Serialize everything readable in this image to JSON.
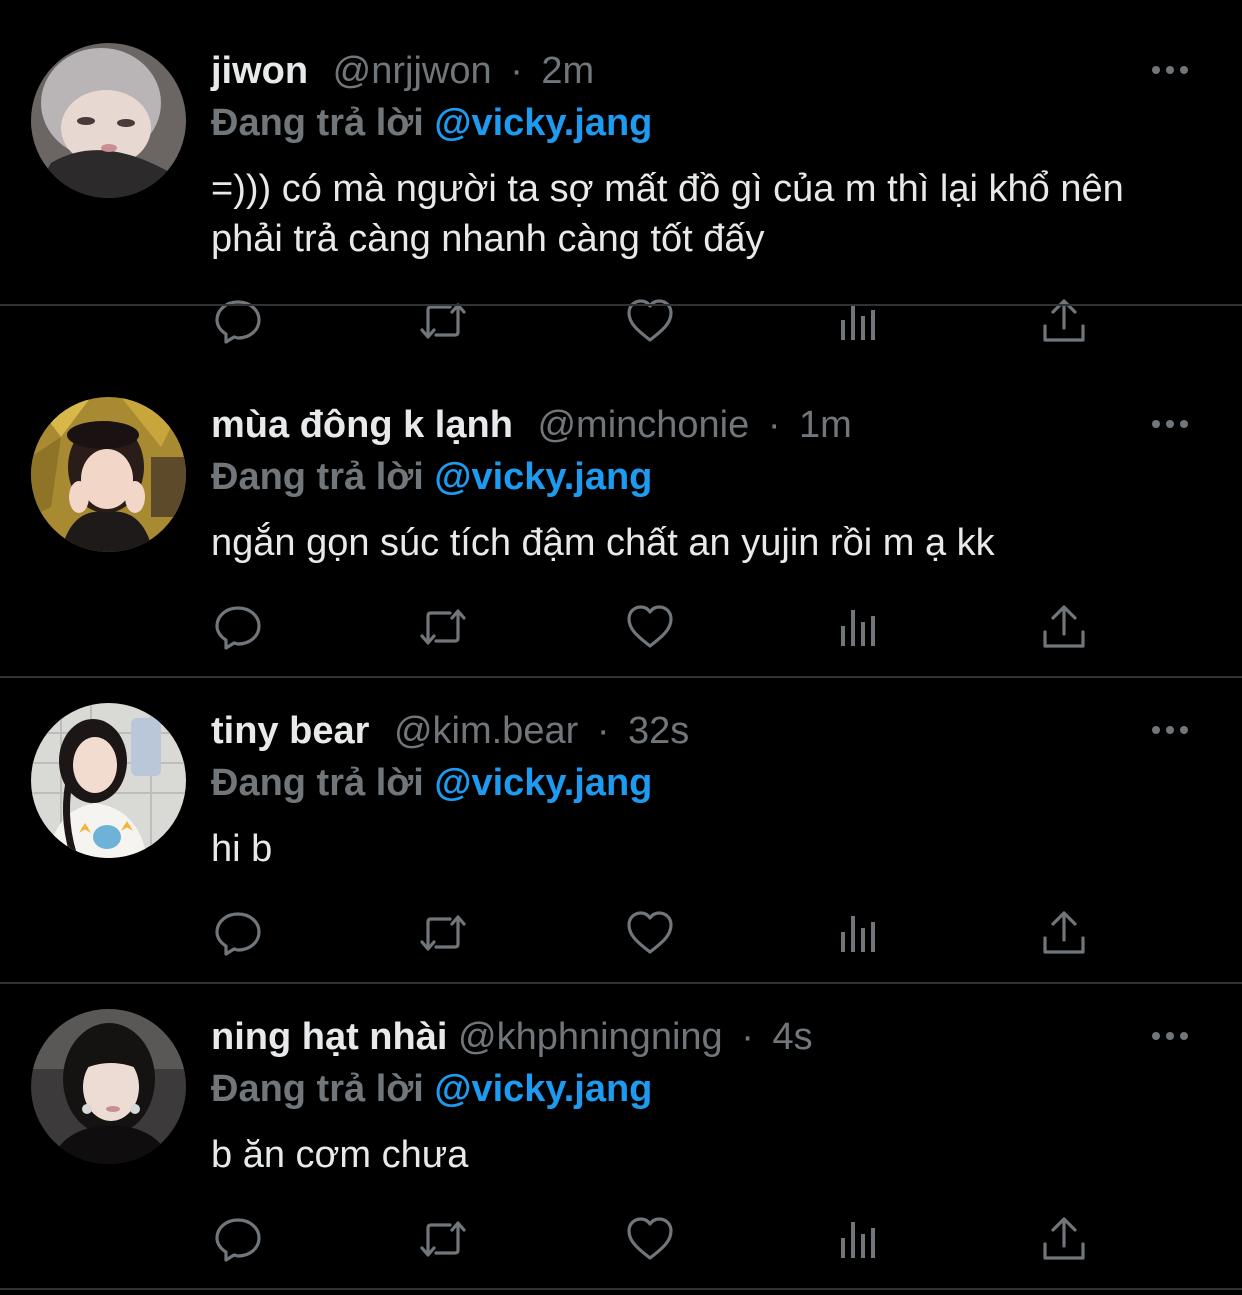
{
  "reply_prefix": "Đang trả lời",
  "colors": {
    "background": "#000000",
    "text": "#e7e9ea",
    "muted": "#71767b",
    "accent": "#1d9bf0",
    "divider": "#2f3336"
  },
  "tweets": [
    {
      "name": "jiwon",
      "handle": "@nrjjwon",
      "time": "2m",
      "reply_to": "@vicky.jang",
      "text": "=))) có mà người ta sợ mất đồ gì của m thì lại khổ nên phải trả càng nhanh càng tốt đấy",
      "avatar_icon": "avatar-jiwon"
    },
    {
      "name": "mùa đông k lạnh",
      "handle": "@minchonie",
      "time": "1m",
      "reply_to": "@vicky.jang",
      "text": "ngắn gọn súc tích đậm chất an yujin rồi m ạ kk",
      "avatar_icon": "avatar-minchonie"
    },
    {
      "name": "tiny bear",
      "handle": "@kim.bear",
      "time": "32s",
      "reply_to": "@vicky.jang",
      "text": "hi b",
      "avatar_icon": "avatar-kim-bear"
    },
    {
      "name": "ning hạt nhài",
      "handle": "@khphningning",
      "time": "4s",
      "reply_to": "@vicky.jang",
      "text": "b ăn cơm chưa",
      "avatar_icon": "avatar-khphningning"
    }
  ],
  "action_icons": [
    "reply-icon",
    "retweet-icon",
    "like-icon",
    "views-icon",
    "share-icon"
  ],
  "dot_separator": "·"
}
